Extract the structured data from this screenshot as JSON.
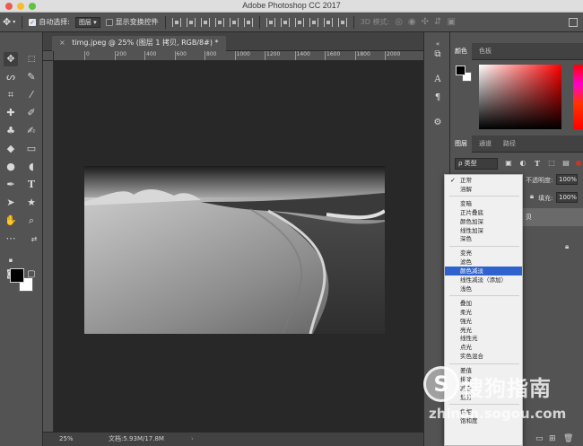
{
  "window": {
    "title": "Adobe Photoshop CC 2017"
  },
  "options_bar": {
    "auto_select_label": "自动选择:",
    "auto_select_target": "图层",
    "show_transform_label": "显示变换控件",
    "mode_3d_label": "3D 模式:"
  },
  "document": {
    "tab_title": "timg.jpeg @ 25% (图层 1 拷贝, RGB/8#) *",
    "close_glyph": "×",
    "zoom": "25%",
    "doc_info": "文档:5.93M/17.8M",
    "ruler_labels": [
      "0",
      "200",
      "400",
      "600",
      "800",
      "1000",
      "1200",
      "1400",
      "1600",
      "1800",
      "2000"
    ]
  },
  "color_panel": {
    "tabs": [
      "颜色",
      "色板"
    ]
  },
  "layers_panel": {
    "tabs": [
      "图层",
      "通道",
      "路径"
    ],
    "filter_label": "ρ 类型",
    "opacity_label": "不透明度:",
    "opacity_value": "100%",
    "fill_label": "填充:",
    "fill_value": "100%",
    "layer_partial_label": "贝"
  },
  "blend_menu": {
    "groups": [
      [
        {
          "label": "正常",
          "checked": true
        },
        {
          "label": "溶解"
        }
      ],
      [
        {
          "label": "变暗"
        },
        {
          "label": "正片叠底"
        },
        {
          "label": "颜色加深"
        },
        {
          "label": "线性加深"
        },
        {
          "label": "深色"
        }
      ],
      [
        {
          "label": "变亮"
        },
        {
          "label": "滤色"
        },
        {
          "label": "颜色减淡",
          "selected": true
        },
        {
          "label": "线性减淡（添加）"
        },
        {
          "label": "浅色"
        }
      ],
      [
        {
          "label": "叠加"
        },
        {
          "label": "柔光"
        },
        {
          "label": "强光"
        },
        {
          "label": "亮光"
        },
        {
          "label": "线性光"
        },
        {
          "label": "点光"
        },
        {
          "label": "实色混合"
        }
      ],
      [
        {
          "label": "差值"
        },
        {
          "label": "排除"
        },
        {
          "label": "减去"
        },
        {
          "label": "划分"
        }
      ],
      [
        {
          "label": "色相"
        },
        {
          "label": "饱和度"
        }
      ]
    ]
  },
  "watermark": {
    "text": "搜狗指南",
    "url": "zhinan.sogou.com"
  },
  "colors": {
    "foreground": "#000000",
    "background": "#ffffff",
    "menu_highlight": "#2f62cc"
  }
}
